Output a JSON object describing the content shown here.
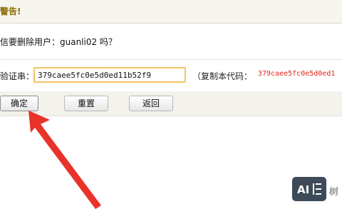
{
  "header": {
    "title": "警告!"
  },
  "prompt": {
    "question": "信要删除用户：guanli02 吗？"
  },
  "verify": {
    "label": "验证串：",
    "value": "379caee5fc0e5d0ed11b52f9",
    "copy_hint": "（复制本代码：",
    "code": "379caee5fc0e5d0ed1"
  },
  "buttons": {
    "confirm": "确定",
    "reset": "重置",
    "back": "返回"
  },
  "watermark": {
    "text": "树"
  },
  "colors": {
    "header_text": "#8a6b00",
    "code_text": "#e0261b",
    "input_border": "#f2c463",
    "arrow": "#e8322a"
  }
}
